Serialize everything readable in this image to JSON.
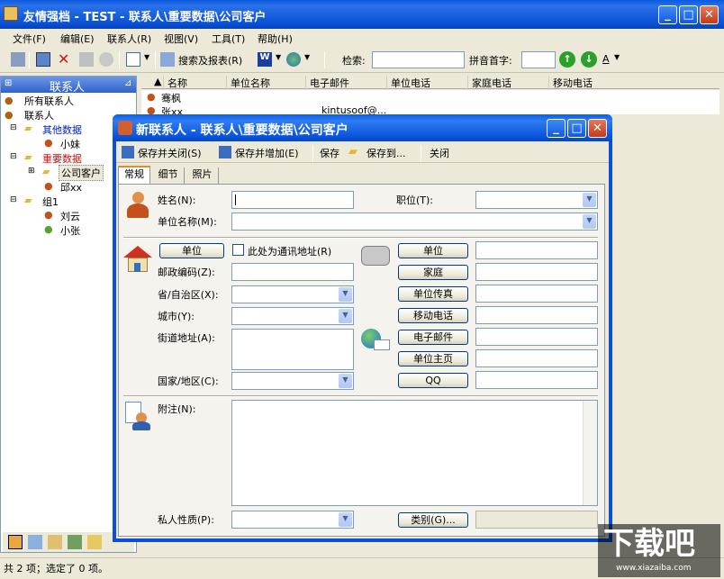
{
  "app": {
    "title": "友情强档 - TEST - 联系人\\重要数据\\公司客户"
  },
  "menu": [
    "文件(F)",
    "编辑(E)",
    "联系人(R)",
    "视图(V)",
    "工具(T)",
    "帮助(H)"
  ],
  "toolbar": {
    "search_report": "搜索及报表(R)",
    "search_label": "检索:",
    "pinyin_label": "拼音首字:",
    "letter": "A"
  },
  "sidebar": {
    "title": "联系人",
    "items": [
      {
        "label": "所有联系人"
      },
      {
        "label": "联系人"
      },
      {
        "label": "其他数据"
      },
      {
        "label": "小妹"
      },
      {
        "label": "重要数据"
      },
      {
        "label": "公司客户"
      },
      {
        "label": "邱xx"
      },
      {
        "label": "组1"
      },
      {
        "label": "刘云"
      },
      {
        "label": "小张"
      }
    ]
  },
  "grid": {
    "columns": [
      "名称",
      "单位名称",
      "电子邮件",
      "单位电话",
      "家庭电话",
      "移动电话"
    ],
    "rows": [
      {
        "name": "骞枫"
      },
      {
        "name": "张xx",
        "email": "kintusoof@..."
      }
    ]
  },
  "status": "共 2 项；选定了 0 项。",
  "dialog": {
    "title": "新联系人 - 联系人\\重要数据\\公司客户",
    "toolbar": {
      "save_close": "保存并关闭(S)",
      "save_add": "保存并增加(E)",
      "save": "保存",
      "save_to": "保存到...",
      "close": "关闭"
    },
    "tabs": [
      "常规",
      "细节",
      "照片"
    ],
    "labels": {
      "name": "姓名(N):",
      "position": "职位(T):",
      "company": "单位名称(M):",
      "zip": "邮政编码(Z):",
      "province": "省/自治区(X):",
      "city": "城市(Y):",
      "street": "街道地址(A):",
      "country": "国家/地区(C):",
      "notes": "附注(N):",
      "privacy": "私人性质(P):"
    },
    "address_btn": "单位",
    "mailing_checkbox": "此处为通讯地址(R)",
    "phone_buttons": [
      "单位",
      "家庭",
      "单位传真",
      "移动电话"
    ],
    "net_buttons": [
      "电子邮件",
      "单位主页",
      "QQ"
    ],
    "category_btn": "类别(G)..."
  },
  "watermark": {
    "big": "下载吧",
    "small": "www.xiazaiba.com"
  }
}
